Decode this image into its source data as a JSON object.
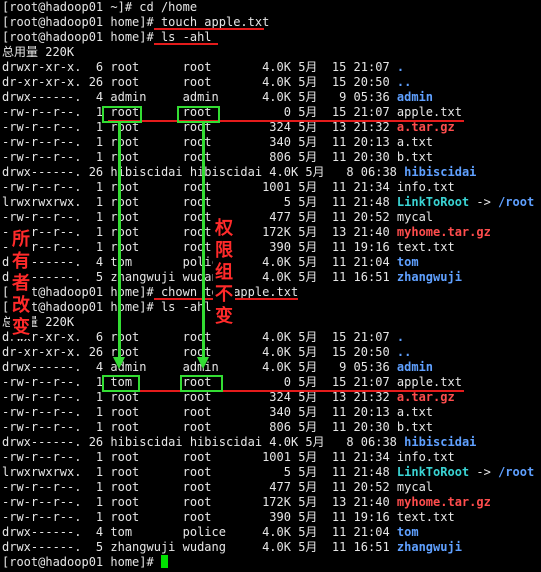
{
  "terminal": {
    "lines": [
      {
        "type": "cmd",
        "text": "[root@hadoop01 ~]# cd /home"
      },
      {
        "type": "cmd",
        "text": "[root@hadoop01 home]# touch apple.txt"
      },
      {
        "type": "cmd",
        "text": "[root@hadoop01 home]# ls -ahl"
      },
      {
        "type": "plain",
        "text": "总用量 220K"
      },
      {
        "type": "entry",
        "meta": "drwxr-xr-x.  6 root      root       4.0K 5月  15 21:07 ",
        "name": ".",
        "kind": "dir"
      },
      {
        "type": "entry",
        "meta": "dr-xr-xr-x. 26 root      root       4.0K 5月  15 20:50 ",
        "name": "..",
        "kind": "dir"
      },
      {
        "type": "entry",
        "meta": "drwx------.  4 admin     admin      4.0K 5月   9 05:36 ",
        "name": "admin",
        "kind": "dir"
      },
      {
        "type": "entry",
        "meta": "-rw-r--r--.  1 root      root          0 5月  15 21:07 ",
        "name": "apple.txt",
        "kind": "file"
      },
      {
        "type": "entry",
        "meta": "-rw-r--r--.  1 root      root        324 5月  13 21:32 ",
        "name": "a.tar.gz",
        "kind": "arc"
      },
      {
        "type": "entry",
        "meta": "-rw-r--r--.  1 root      root        340 5月  11 20:13 ",
        "name": "a.txt",
        "kind": "file"
      },
      {
        "type": "entry",
        "meta": "-rw-r--r--.  1 root      root        806 5月  11 20:30 ",
        "name": "b.txt",
        "kind": "file"
      },
      {
        "type": "entry",
        "meta": "drwx------. 26 hibiscidai hibiscidai 4.0K 5月   8 06:38 ",
        "name": "hibiscidai",
        "kind": "dir"
      },
      {
        "type": "entry",
        "meta": "-rw-r--r--.  1 root      root       1001 5月  11 21:34 ",
        "name": "info.txt",
        "kind": "file"
      },
      {
        "type": "link",
        "meta": "lrwxrwxrwx.  1 root      root          5 5月  11 21:48 ",
        "name": "LinkToRoot",
        "arrow": " -> ",
        "target": "/root"
      },
      {
        "type": "entry",
        "meta": "-rw-r--r--.  1 root      root        477 5月  11 20:52 ",
        "name": "mycal",
        "kind": "file"
      },
      {
        "type": "entry",
        "meta": "-rw-r--r--.  1 root      root       172K 5月  13 21:40 ",
        "name": "myhome.tar.gz",
        "kind": "arc"
      },
      {
        "type": "entry",
        "meta": "-rw-r--r--.  1 root      root        390 5月  11 19:16 ",
        "name": "text.txt",
        "kind": "file"
      },
      {
        "type": "entry",
        "meta": "drwx------.  4 tom       police     4.0K 5月  11 21:04 ",
        "name": "tom",
        "kind": "dir"
      },
      {
        "type": "entry",
        "meta": "drwx------.  5 zhangwuji wudang     4.0K 5月  11 16:51 ",
        "name": "zhangwuji",
        "kind": "dir"
      },
      {
        "type": "cmd",
        "text": "[root@hadoop01 home]# chown tom apple.txt"
      },
      {
        "type": "cmd",
        "text": "[root@hadoop01 home]# ls -ahl"
      },
      {
        "type": "plain",
        "text": "总用量 220K"
      },
      {
        "type": "entry",
        "meta": "drwxr-xr-x.  6 root      root       4.0K 5月  15 21:07 ",
        "name": ".",
        "kind": "dir"
      },
      {
        "type": "entry",
        "meta": "dr-xr-xr-x. 26 root      root       4.0K 5月  15 20:50 ",
        "name": "..",
        "kind": "dir"
      },
      {
        "type": "entry",
        "meta": "drwx------.  4 admin     admin      4.0K 5月   9 05:36 ",
        "name": "admin",
        "kind": "dir"
      },
      {
        "type": "entry",
        "meta": "-rw-r--r--.  1 tom       root          0 5月  15 21:07 ",
        "name": "apple.txt",
        "kind": "file"
      },
      {
        "type": "entry",
        "meta": "-rw-r--r--.  1 root      root        324 5月  13 21:32 ",
        "name": "a.tar.gz",
        "kind": "arc"
      },
      {
        "type": "entry",
        "meta": "-rw-r--r--.  1 root      root        340 5月  11 20:13 ",
        "name": "a.txt",
        "kind": "file"
      },
      {
        "type": "entry",
        "meta": "-rw-r--r--.  1 root      root        806 5月  11 20:30 ",
        "name": "b.txt",
        "kind": "file"
      },
      {
        "type": "entry",
        "meta": "drwx------. 26 hibiscidai hibiscidai 4.0K 5月   8 06:38 ",
        "name": "hibiscidai",
        "kind": "dir"
      },
      {
        "type": "entry",
        "meta": "-rw-r--r--.  1 root      root       1001 5月  11 21:34 ",
        "name": "info.txt",
        "kind": "file"
      },
      {
        "type": "link",
        "meta": "lrwxrwxrwx.  1 root      root          5 5月  11 21:48 ",
        "name": "LinkToRoot",
        "arrow": " -> ",
        "target": "/root"
      },
      {
        "type": "entry",
        "meta": "-rw-r--r--.  1 root      root        477 5月  11 20:52 ",
        "name": "mycal",
        "kind": "file"
      },
      {
        "type": "entry",
        "meta": "-rw-r--r--.  1 root      root       172K 5月  13 21:40 ",
        "name": "myhome.tar.gz",
        "kind": "arc"
      },
      {
        "type": "entry",
        "meta": "-rw-r--r--.  1 root      root        390 5月  11 19:16 ",
        "name": "text.txt",
        "kind": "file"
      },
      {
        "type": "entry",
        "meta": "drwx------.  4 tom       police     4.0K 5月  11 21:04 ",
        "name": "tom",
        "kind": "dir"
      },
      {
        "type": "entry",
        "meta": "drwx------.  5 zhangwuji wudang     4.0K 5月  11 16:51 ",
        "name": "zhangwuji",
        "kind": "dir"
      },
      {
        "type": "prompt",
        "text": "[root@hadoop01 home]# "
      }
    ]
  },
  "annotations": {
    "owner_label": "所有者改变",
    "group_label": "权限组不变"
  },
  "colors": {
    "background": "#000000",
    "text": "#e6e6e6",
    "directory": "#5fa0ff",
    "archive": "#ff4d4d",
    "symlink": "#3ad4d4",
    "highlight_box": "#33dd33",
    "underline": "#e41b1b",
    "cursor": "#00e000"
  }
}
